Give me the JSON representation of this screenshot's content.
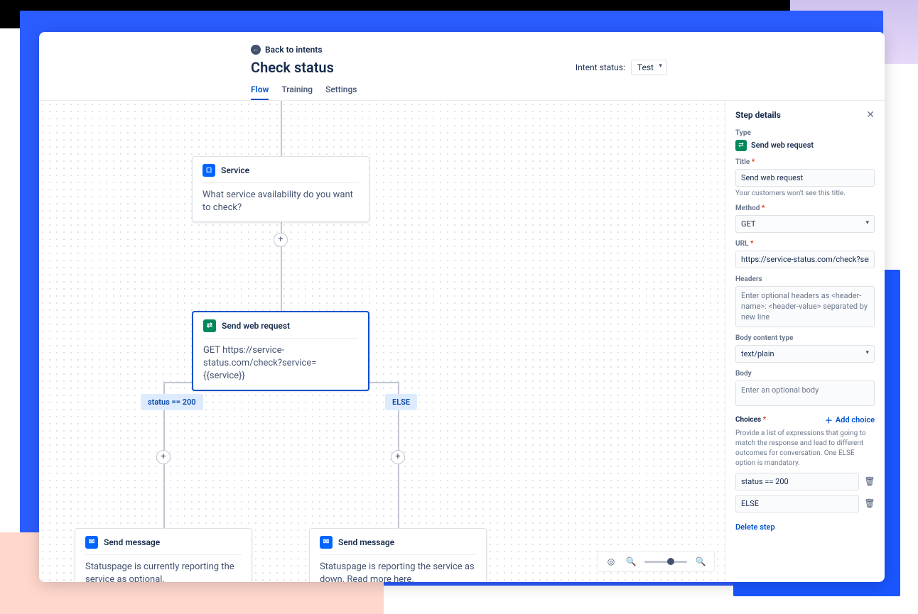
{
  "header": {
    "back_label": "Back to intents",
    "title": "Check status",
    "intent_status_label": "Intent status:",
    "intent_status_value": "Test"
  },
  "tabs": [
    {
      "label": "Flow",
      "active": true
    },
    {
      "label": "Training",
      "active": false
    },
    {
      "label": "Settings",
      "active": false
    }
  ],
  "flow": {
    "node_service": {
      "title": "Service",
      "body": "What service availability do you want to check?"
    },
    "node_web": {
      "title": "Send web request",
      "body": "GET https://service-status.com/check?service={{service}}"
    },
    "branch_left": "status == 200",
    "branch_right": "ELSE",
    "node_msg_left": {
      "title": "Send message",
      "body": "Statuspage is currently reporting the service as optional."
    },
    "node_msg_right": {
      "title": "Send message",
      "body": "Statuspage is reporting the service as down. Read more here."
    }
  },
  "panel": {
    "title": "Step details",
    "type_label": "Type",
    "type_value": "Send web request",
    "title_label": "Title",
    "title_value": "Send web request",
    "title_hint": "Your customers won't see this title.",
    "method_label": "Method",
    "method_value": "GET",
    "url_label": "URL",
    "url_value": "https://service-status.com/check?service={{service}}",
    "headers_label": "Headers",
    "headers_placeholder": "Enter optional headers as <header-name>: <header-value> separated by new line",
    "body_type_label": "Body content type",
    "body_type_value": "text/plain",
    "body_label": "Body",
    "body_placeholder": "Enter an optional body",
    "choices_label": "Choices",
    "add_choice_label": "Add choice",
    "choices_desc": "Provide a list of expressions that going to match the response and lead to different outcomes for conversation. One ELSE option is mandatory.",
    "choices": [
      "status == 200",
      "ELSE"
    ],
    "delete_step": "Delete step"
  }
}
